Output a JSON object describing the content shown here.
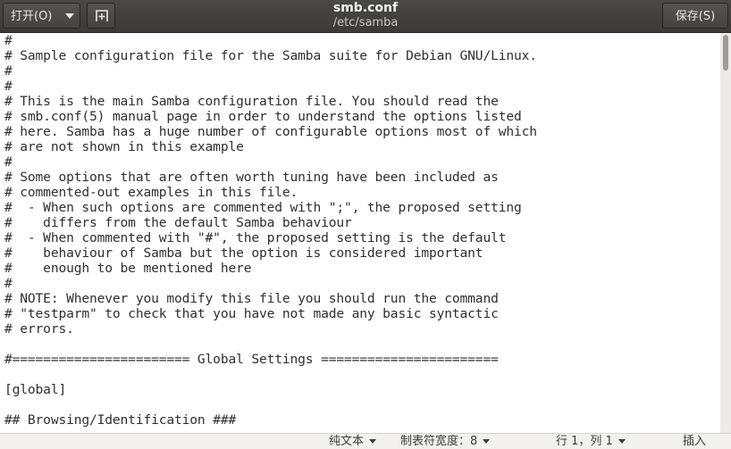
{
  "header": {
    "open_label": "打开(O)",
    "title": "smb.conf",
    "path": "/etc/samba",
    "save_label": "保存(S)",
    "icons": {
      "open_menu": "chevron-down-icon",
      "new_tab": "new-tab-icon"
    }
  },
  "editor": {
    "lines": [
      "#",
      "# Sample configuration file for the Samba suite for Debian GNU/Linux.",
      "#",
      "#",
      "# This is the main Samba configuration file. You should read the",
      "# smb.conf(5) manual page in order to understand the options listed",
      "# here. Samba has a huge number of configurable options most of which",
      "# are not shown in this example",
      "#",
      "# Some options that are often worth tuning have been included as",
      "# commented-out examples in this file.",
      "#  - When such options are commented with \";\", the proposed setting",
      "#    differs from the default Samba behaviour",
      "#  - When commented with \"#\", the proposed setting is the default",
      "#    behaviour of Samba but the option is considered important",
      "#    enough to be mentioned here",
      "#",
      "# NOTE: Whenever you modify this file you should run the command",
      "# \"testparm\" to check that you have not made any basic syntactic",
      "# errors.",
      "",
      "#======================= Global Settings =======================",
      "",
      "[global]",
      "",
      "## Browsing/Identification ###"
    ]
  },
  "statusbar": {
    "language": "纯文本",
    "tab_width": "制表符宽度：8",
    "position": "行 1，列 1",
    "mode": "插入"
  }
}
